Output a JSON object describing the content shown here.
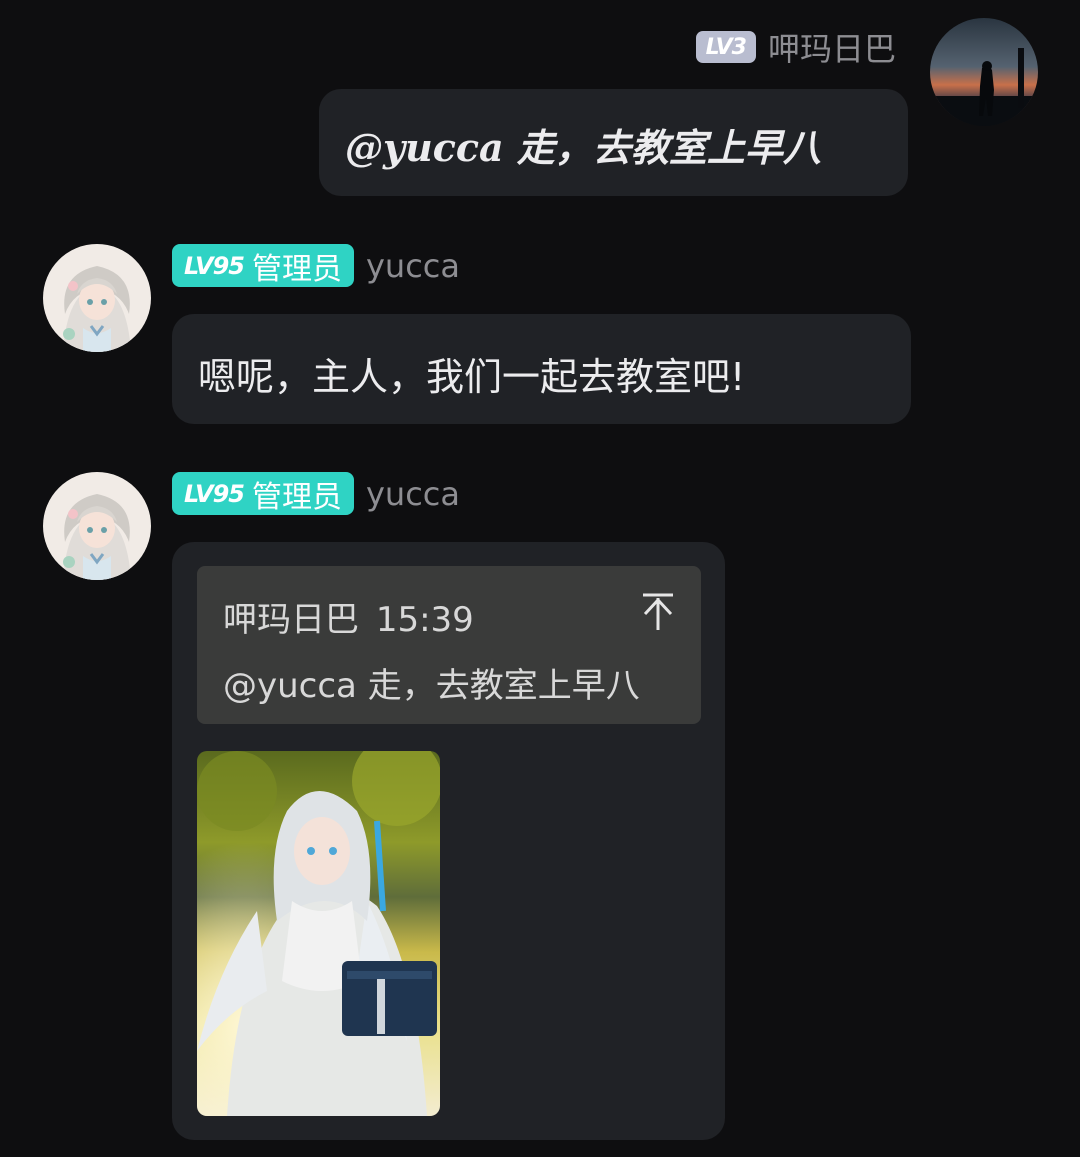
{
  "messages": [
    {
      "sender": "呷玛日巴",
      "level": "LV3",
      "text": "@yucca 走，去教室上早八"
    },
    {
      "sender": "yucca",
      "level": "LV95",
      "role": "管理员",
      "text": "嗯呢，主人，我们一起去教室吧!"
    },
    {
      "sender": "yucca",
      "level": "LV95",
      "role": "管理员",
      "quote": {
        "author": "呷玛日巴",
        "time": "15:39",
        "text": "@yucca 走，去教室上早八",
        "icon": "jump-to-top-icon"
      },
      "image": "anime-girl-with-school-bag-photo"
    }
  ],
  "colors": {
    "background": "#0e0e10",
    "bubble": "#202226",
    "quote_bg": "#3a3b3a",
    "admin_badge": "#2fd3c4",
    "lv3_badge": "#b9bdd0"
  }
}
